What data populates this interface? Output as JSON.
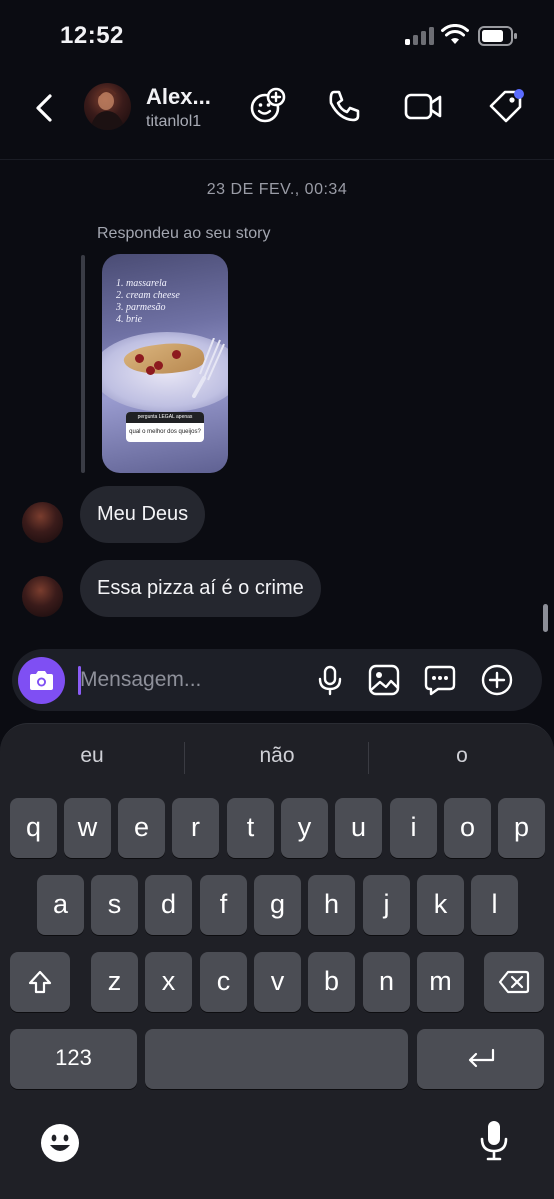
{
  "status_bar": {
    "time": "12:52"
  },
  "header": {
    "name": "Alex...",
    "username": "titanlol1",
    "icons": [
      "back-icon",
      "sticker-add-icon",
      "phone-icon",
      "video-camera-icon",
      "tag-icon"
    ]
  },
  "thread": {
    "timestamp": "23 DE FEV., 00:34",
    "reply_label": "Respondeu ao seu story",
    "story": {
      "list": [
        "1. massarela",
        "2. cream cheese",
        "3. parmesão",
        "4. brie"
      ],
      "question_header": "pergunta LEGAL apenas",
      "question_text": "qual o melhor dos queijos?"
    },
    "messages": [
      {
        "text": "Meu Deus"
      },
      {
        "text": "Essa pizza aí é o crime"
      }
    ]
  },
  "composer": {
    "placeholder": "Mensagem...",
    "icons": [
      "camera-icon",
      "microphone-icon",
      "gallery-icon",
      "sticker-message-icon",
      "plus-circle-icon"
    ]
  },
  "keyboard": {
    "suggestions": [
      "eu",
      "não",
      "o"
    ],
    "row1": [
      "q",
      "w",
      "e",
      "r",
      "t",
      "y",
      "u",
      "i",
      "o",
      "p"
    ],
    "row2": [
      "a",
      "s",
      "d",
      "f",
      "g",
      "h",
      "j",
      "k",
      "l"
    ],
    "row3": [
      "z",
      "x",
      "c",
      "v",
      "b",
      "n",
      "m"
    ],
    "numbers_label": "123",
    "icons": [
      "shift-icon",
      "delete-icon",
      "return-icon",
      "emoji-icon",
      "dictation-icon"
    ]
  },
  "colors": {
    "accent": "#7f4ff3",
    "background": "#0b0c12",
    "bubble": "#25272f",
    "notification_dot": "#5b6cff"
  }
}
